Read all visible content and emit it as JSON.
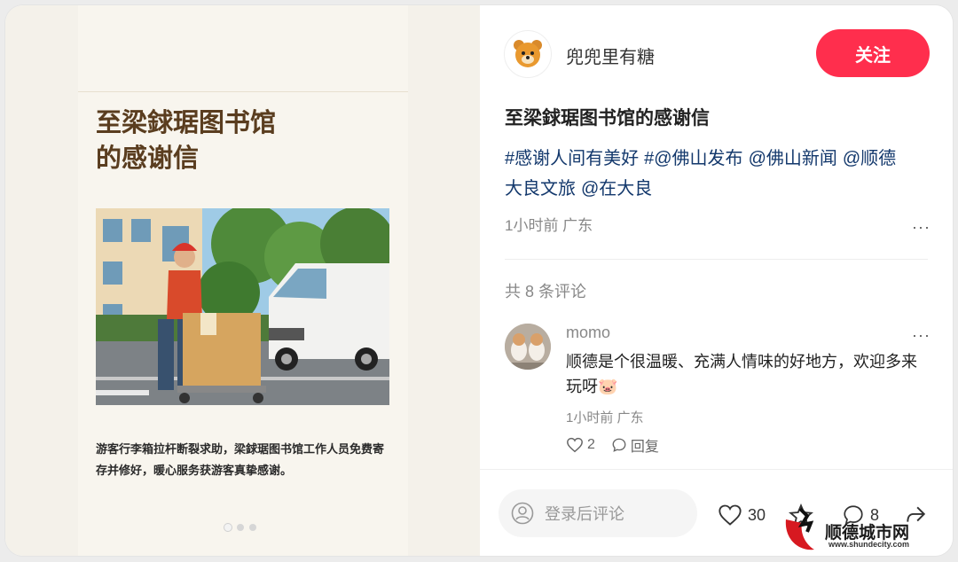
{
  "post": {
    "image_title": "至梁銶琚图书馆\n的感谢信",
    "image_caption": "游客行李箱拉杆断裂求助，梁銶琚图书馆工作人员免费寄存并修好，暖心服务获游客真挚感谢。",
    "author": "兜兜里有糖",
    "follow_label": "关注",
    "title": "至梁銶琚图书馆的感谢信",
    "tags": [
      "#感谢人间有美好",
      "#@佛山发布",
      "@佛山新闻",
      "@顺德",
      "大良文旅",
      "@在大良"
    ],
    "meta": "1小时前 广东",
    "more": "···"
  },
  "comments": {
    "count_label": "共 8 条评论",
    "items": [
      {
        "name": "momo",
        "text": "顺德是个很温暖、充满人情味的好地方，欢迎多来玩呀🐷",
        "time": "1小时前 广东",
        "likes": "2",
        "reply_label": "回复",
        "more": "···"
      }
    ]
  },
  "bottom": {
    "comment_placeholder": "登录后评论",
    "likes": "30",
    "comments": "8"
  },
  "watermark": {
    "name": "顺德城市网",
    "url": "www.shundecity.com"
  },
  "colors": {
    "accent": "#ff2e4d",
    "tag": "#13386c"
  }
}
